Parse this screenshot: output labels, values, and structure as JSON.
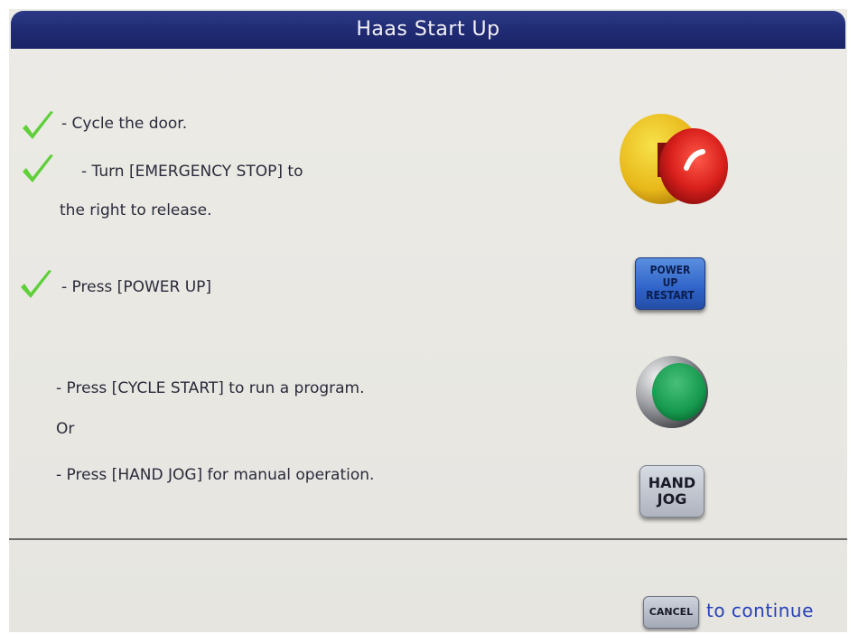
{
  "title": "Haas Start Up",
  "steps": {
    "cycle_door": "- Cycle the door.",
    "emergency_line1": "- Turn [EMERGENCY STOP] to",
    "emergency_line2": "the right to release.",
    "power_up": "- Press [POWER UP]",
    "cycle_start": "- Press [CYCLE START] to run a program.",
    "or": "Or",
    "hand_jog": "- Press [HAND JOG] for manual operation."
  },
  "keys": {
    "power_up_line1": "POWER",
    "power_up_line2": "UP",
    "power_up_line3": "RESTART",
    "hand_jog_line1": "HAND",
    "hand_jog_line2": "JOG",
    "cancel": "CANCEL"
  },
  "footer": {
    "continue_text": "to continue"
  },
  "colors": {
    "titlebar": "#1f2a72",
    "check": "#5fcf3a",
    "continue_text": "#2741b8"
  },
  "icons": {
    "check": "check-icon",
    "estop": "emergency-stop-icon",
    "cycle_start": "cycle-start-icon"
  }
}
